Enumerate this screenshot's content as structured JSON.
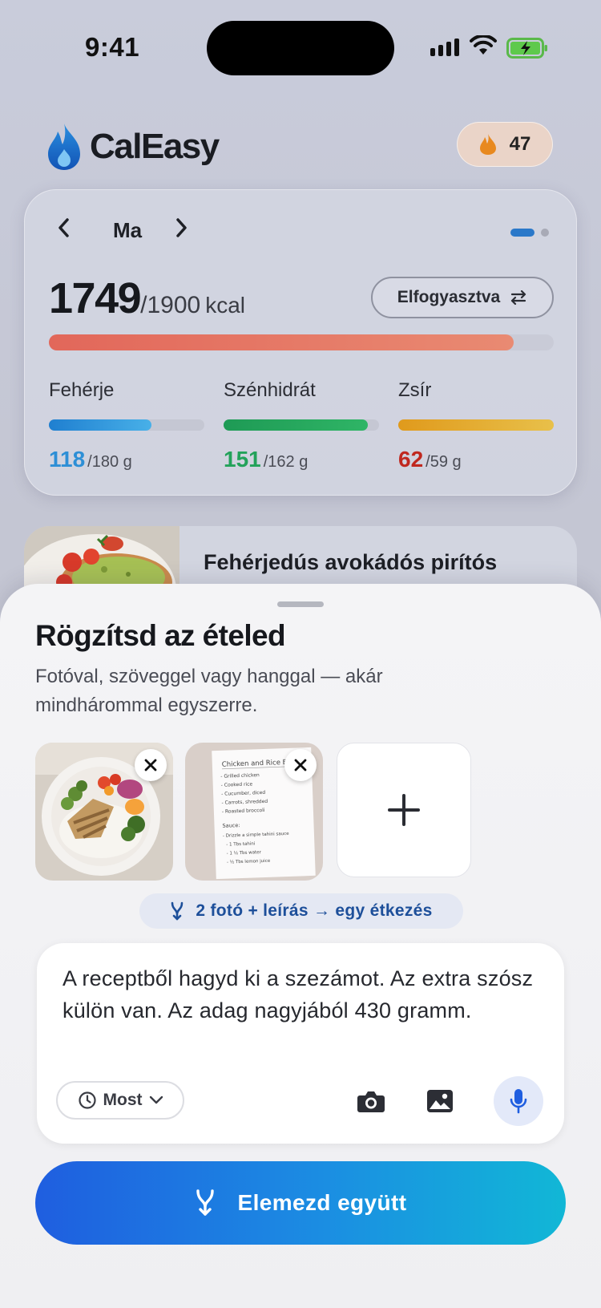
{
  "status_bar": {
    "time": "9:41"
  },
  "header": {
    "app_name": "CalEasy",
    "streak_count": "47"
  },
  "summary": {
    "date_label": "Ma",
    "kcal_consumed": "1749",
    "kcal_goal": "/1900",
    "kcal_unit": "kcal",
    "kcal_progress": 0.92,
    "mode_label": "Elfogyasztva",
    "macros": [
      {
        "name": "Fehérje",
        "current": "118",
        "goal": "/180 g",
        "progress": 0.66,
        "color": "#2d8fd6"
      },
      {
        "name": "Szénhidrát",
        "current": "151",
        "goal": "/162 g",
        "progress": 0.93,
        "color": "#23a25a"
      },
      {
        "name": "Zsír",
        "current": "62",
        "goal": "/59 g",
        "progress": 1.0,
        "color": "#e3a82a"
      }
    ]
  },
  "meal": {
    "title": "Fehérjedús avokádós pirítós"
  },
  "sheet": {
    "title": "Rögzítsd az ételed",
    "subtitle": "Fotóval, szöveggel vagy hanggal — akár mindhárommal egyszerre.",
    "recipe_note": {
      "heading": "Chicken and Rice Bowl",
      "lines": [
        "- Grilled chicken",
        "- Cooked rice",
        "- Cucumber, diced",
        "- Carrots, shredded",
        "- Roasted broccoli"
      ],
      "sauce_heading": "Sauce:",
      "sauce_lines": [
        "- Drizzle a simple tahini sauce",
        "- 1 Tbs tahini",
        "- 1 ½ Tbs water",
        "- ½ Tbs lemon juice"
      ]
    },
    "combine_label": "2 fotó + leírás → egy étkezés",
    "input_text": "A receptből hagyd ki a szezámot. Az extra szósz külön van. Az adag nagyjából 430 gramm.",
    "time_label": "Most",
    "analyze_label": "Elemezd együtt"
  },
  "colors": {
    "accent": "#1f5ee0",
    "kcal_bar": "#e2675a",
    "streak_flame": "#e8891f"
  }
}
